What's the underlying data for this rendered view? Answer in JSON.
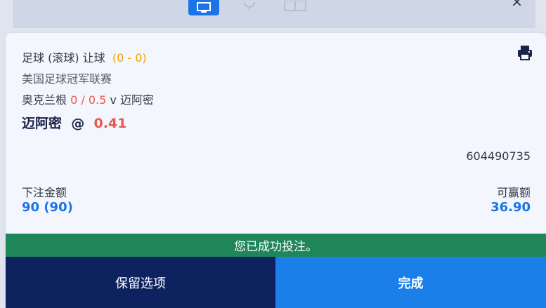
{
  "header": {
    "close_label": "×",
    "icons": [
      "tv-icon",
      "microphone-icon",
      "court-icon"
    ]
  },
  "bet": {
    "market": "足球 (滚球) 让球",
    "score": "(0 - 0)",
    "league": "美国足球冠军联赛",
    "home_team": "奥克兰根",
    "handicap": "0 / 0.5",
    "versus": "v",
    "away_team": "迈阿密",
    "selection": "迈阿密",
    "at": "@",
    "odds": "0.41",
    "reference": "604490735",
    "stake_label": "下注金额",
    "stake_value": "90 (90)",
    "win_label": "可赢额",
    "win_value": "36.90"
  },
  "status": {
    "message": "您已成功投注。"
  },
  "actions": {
    "keep_label": "保留选项",
    "done_label": "完成"
  },
  "colors": {
    "accent": "#1a73e8",
    "success": "#1e8658",
    "keep_button": "#0e2260",
    "done_button": "#1a7fe8",
    "score": "#f0a500",
    "odds": "#e85a4f"
  }
}
